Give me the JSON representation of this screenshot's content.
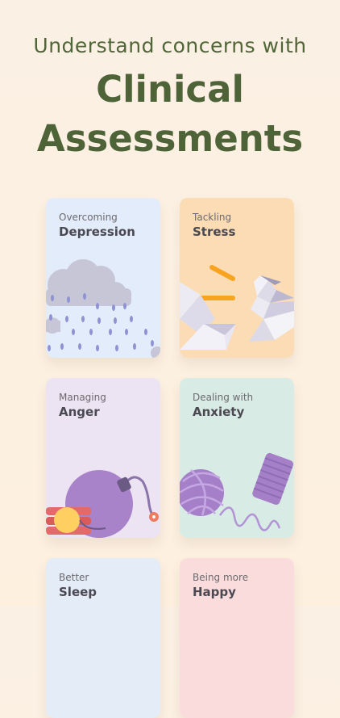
{
  "header": {
    "subtitle": "Understand concerns with",
    "title_line1": "Clinical",
    "title_line2": "Assessments"
  },
  "cards": [
    {
      "eyebrow": "Overcoming",
      "title": "Depression",
      "color": "#e3ecfa",
      "icon": "rain-cloud-icon"
    },
    {
      "eyebrow": "Tackling",
      "title": "Stress",
      "color": "#fbdcb5",
      "icon": "paper-crane-icon"
    },
    {
      "eyebrow": "Managing",
      "title": "Anger",
      "color": "#ece3f3",
      "icon": "bomb-icon"
    },
    {
      "eyebrow": "Dealing with",
      "title": "Anxiety",
      "color": "#d9ebe5",
      "icon": "yarn-ball-icon"
    },
    {
      "eyebrow": "Better",
      "title": "Sleep",
      "color": "#e4ecf8",
      "icon": ""
    },
    {
      "eyebrow": "Being more",
      "title": "Happy",
      "color": "#fbdcdc",
      "icon": ""
    }
  ]
}
